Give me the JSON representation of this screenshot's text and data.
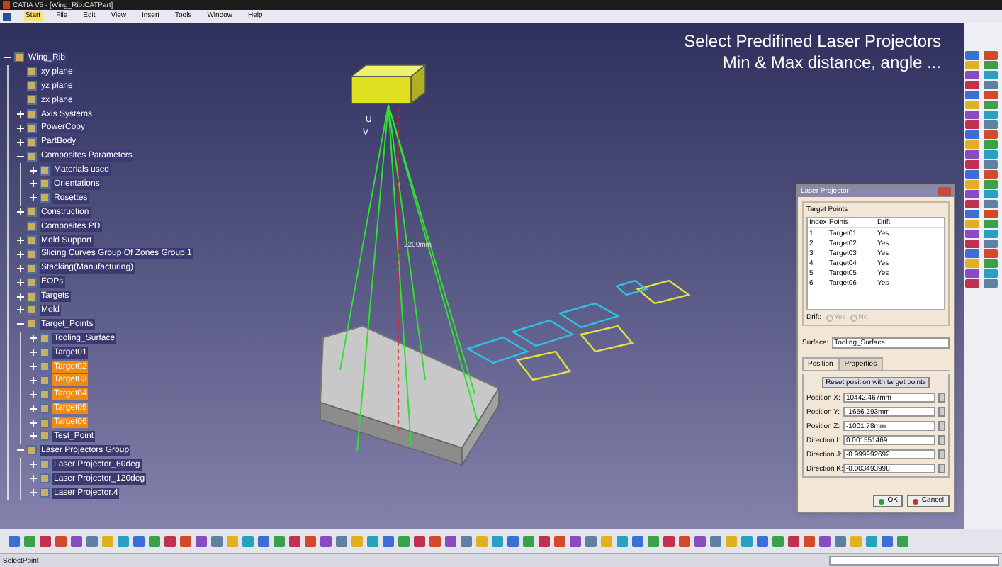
{
  "window": {
    "title": "CATIA V5 - [Wing_Rib.CATPart]"
  },
  "menu": [
    {
      "label": "Start",
      "selected": true
    },
    {
      "label": "File",
      "selected": false
    },
    {
      "label": "Edit",
      "selected": false
    },
    {
      "label": "View",
      "selected": false
    },
    {
      "label": "Insert",
      "selected": false
    },
    {
      "label": "Tools",
      "selected": false
    },
    {
      "label": "Window",
      "selected": false
    },
    {
      "label": "Help",
      "selected": false
    }
  ],
  "caption": [
    "Select Predifined Laser Projectors",
    "Min & Max distance, angle ..."
  ],
  "tree": [
    {
      "label": "Wing_Rib",
      "selected": false,
      "expanded": true,
      "children": [
        {
          "label": "xy plane",
          "selected": false
        },
        {
          "label": "yz plane",
          "selected": false
        },
        {
          "label": "zx plane",
          "selected": false
        },
        {
          "label": "Axis Systems",
          "selected": false,
          "expanded": false
        },
        {
          "label": "PowerCopy",
          "selected": false,
          "expanded": false
        },
        {
          "label": "PartBody",
          "selected": false,
          "expanded": false
        },
        {
          "label": "Composites Parameters",
          "selected": false,
          "expanded": true,
          "children": [
            {
              "label": "Materials used",
              "selected": false,
              "expanded": false
            },
            {
              "label": "Orientations",
              "selected": false,
              "expanded": false
            },
            {
              "label": "Rosettes",
              "selected": false,
              "expanded": false
            }
          ]
        },
        {
          "label": "Construction",
          "selected": false,
          "expanded": false
        },
        {
          "label": "Composites PD",
          "selected": false
        },
        {
          "label": "Mold Support",
          "selected": false,
          "expanded": false
        },
        {
          "label": "Slicing Curves Group Of Zones Group.1",
          "selected": false,
          "expanded": false
        },
        {
          "label": "Stacking(Manufacturing)",
          "selected": false,
          "expanded": false
        },
        {
          "label": "EOPs",
          "selected": false,
          "expanded": false
        },
        {
          "label": "Targets",
          "selected": false,
          "expanded": false
        },
        {
          "label": "Mold",
          "selected": false,
          "expanded": false
        },
        {
          "label": "Target_Points",
          "selected": false,
          "expanded": true,
          "children": [
            {
              "label": "Tooling_Surface",
              "selected": false,
              "expanded": false
            },
            {
              "label": "Target01",
              "selected": false,
              "expanded": false
            },
            {
              "label": "Target02",
              "selected": true,
              "expanded": false
            },
            {
              "label": "Target03",
              "selected": true,
              "expanded": false
            },
            {
              "label": "Target04",
              "selected": true,
              "expanded": false
            },
            {
              "label": "Target05",
              "selected": true,
              "expanded": false
            },
            {
              "label": "Target06",
              "selected": true,
              "expanded": false
            },
            {
              "label": "Test_Point",
              "selected": false,
              "expanded": false
            }
          ]
        },
        {
          "label": "Laser Projectors Group",
          "selected": false,
          "expanded": true,
          "children": [
            {
              "label": "Laser Projector_60deg",
              "selected": false,
              "expanded": false
            },
            {
              "label": "Laser Projector_120deg",
              "selected": false,
              "expanded": false
            },
            {
              "label": "Laser Projector.4",
              "selected": false,
              "expanded": false
            }
          ]
        }
      ]
    }
  ],
  "scene": {
    "axis_labels": [
      "U",
      "V"
    ],
    "dimension": "2200mm"
  },
  "dialog": {
    "title": "Laser Projector",
    "group": "Target Points",
    "columns": [
      "Index",
      "Points",
      "Drift"
    ],
    "rows": [
      [
        "1",
        "Target01",
        "Yes"
      ],
      [
        "2",
        "Target02",
        "Yes"
      ],
      [
        "3",
        "Target03",
        "Yes"
      ],
      [
        "4",
        "Target04",
        "Yes"
      ],
      [
        "5",
        "Target05",
        "Yes"
      ],
      [
        "6",
        "Target06",
        "Yes"
      ]
    ],
    "drift": {
      "label": "Drift:",
      "options": [
        {
          "label": "Yes",
          "selected": false,
          "disabled": true
        },
        {
          "label": "No",
          "selected": false,
          "disabled": true
        }
      ]
    },
    "surface": {
      "label": "Surface:",
      "value": "Tooling_Surface"
    },
    "tabs": [
      {
        "label": "Position",
        "selected": true
      },
      {
        "label": "Properties",
        "selected": false
      }
    ],
    "reset_button": "Reset position with target points",
    "fields": [
      {
        "label": "Position X:",
        "value": "10442.467mm"
      },
      {
        "label": "Position Y:",
        "value": "-1656.293mm"
      },
      {
        "label": "Position Z:",
        "value": "-1001.78mm"
      },
      {
        "label": "Direction I:",
        "value": "0.001551469"
      },
      {
        "label": "Direction J:",
        "value": "-0.999992692"
      },
      {
        "label": "Direction K:",
        "value": "-0.003493998"
      }
    ],
    "buttons": [
      {
        "kind": "ok",
        "label": "OK"
      },
      {
        "kind": "cancel",
        "label": "Cancel"
      }
    ]
  },
  "status_bar": "SelectPoint"
}
